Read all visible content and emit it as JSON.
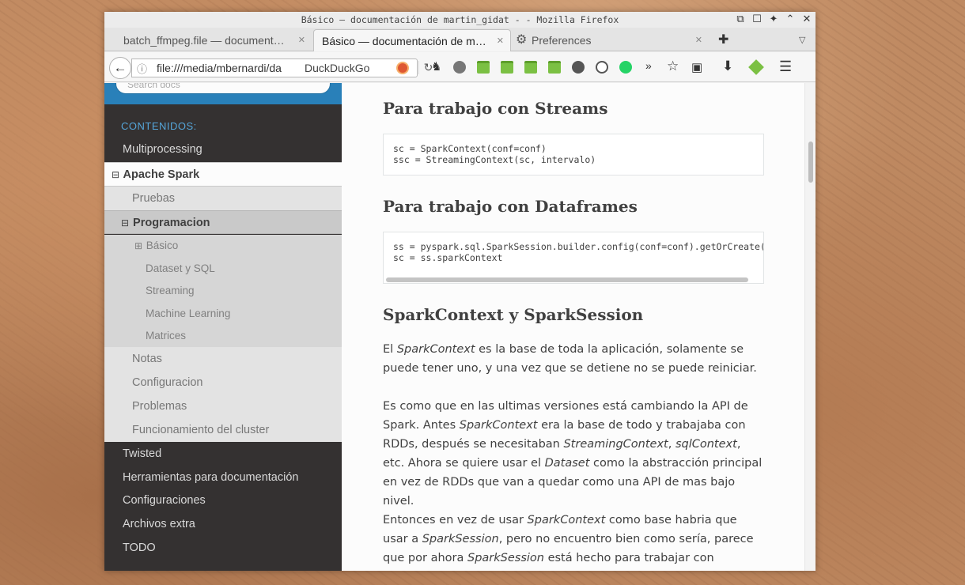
{
  "window": {
    "title": "Básico — documentación de martin_gidat - - Mozilla Firefox",
    "controls": [
      "restore-icon",
      "maximize-icon",
      "pin-icon",
      "up-icon",
      "close-icon"
    ]
  },
  "tabs": [
    {
      "label": "batch_ffmpeg.file — document…",
      "active": false
    },
    {
      "label": "Básico — documentación de m…",
      "active": true
    },
    {
      "label": "Preferences",
      "active": false
    }
  ],
  "navbar": {
    "url": "file:///media/mbernardi/da",
    "search_engine": "DuckDuckGo"
  },
  "sidebar": {
    "search_placeholder": "Search docs",
    "caption": "CONTENIDOS:",
    "items": [
      {
        "label": "Multiprocessing",
        "level": 1
      },
      {
        "label": "Apache Spark",
        "level": 1,
        "current": true
      },
      {
        "label": "Pruebas",
        "level": 2
      },
      {
        "label": "Programacion",
        "level": 2,
        "current": true
      },
      {
        "label": "Básico",
        "level": 3,
        "current": true
      },
      {
        "label": "Dataset y SQL",
        "level": 3
      },
      {
        "label": "Streaming",
        "level": 3
      },
      {
        "label": "Machine Learning",
        "level": 3
      },
      {
        "label": "Matrices",
        "level": 3
      },
      {
        "label": "Notas",
        "level": 2
      },
      {
        "label": "Configuracion",
        "level": 2
      },
      {
        "label": "Problemas",
        "level": 2
      },
      {
        "label": "Funcionamiento del cluster",
        "level": 2
      },
      {
        "label": "Twisted",
        "level": 1
      },
      {
        "label": "Herramientas para documentación",
        "level": 1
      },
      {
        "label": "Configuraciones",
        "level": 1
      },
      {
        "label": "Archivos extra",
        "level": 1
      },
      {
        "label": "TODO",
        "level": 1
      }
    ],
    "toggle_minus": "⊟",
    "toggle_plus": "⊞"
  },
  "content": {
    "h_streams": "Para trabajo con Streams",
    "code_streams": [
      "sc = SparkContext(conf=conf)",
      "ssc = StreamingContext(sc, intervalo)"
    ],
    "h_dataframes": "Para trabajo con Dataframes",
    "code_dataframes": [
      "ss = pyspark.sql.SparkSession.builder.config(conf=conf).getOrCreate()",
      "sc = ss.sparkContext"
    ],
    "h_context": "SparkContext y SparkSession",
    "p1": "El <em>SparkContext</em> es la base de toda la aplicación, solamente se puede tener uno, y una vez que se detiene no se puede reiniciar.",
    "p2": "Es como que en las ultimas versiones está cambiando la API de Spark. Antes <em>SparkContext</em> era la base de todo y trabajaba con RDDs, después se necesitaban <em>StreamingContext</em>, <em>sqlContext</em>, etc. Ahora se quiere usar el <em>Dataset</em> como la abstracción principal en vez de RDDs que van a quedar como una API de mas bajo nivel.",
    "p3": "Entonces en vez de usar <em>SparkContext</em> como base habria que usar a <em>SparkSession</em>, pero no encuentro bien como sería, parece que por ahora <em>SparkSession</em> está hecho para trabajar con Dataset. Creo que"
  }
}
